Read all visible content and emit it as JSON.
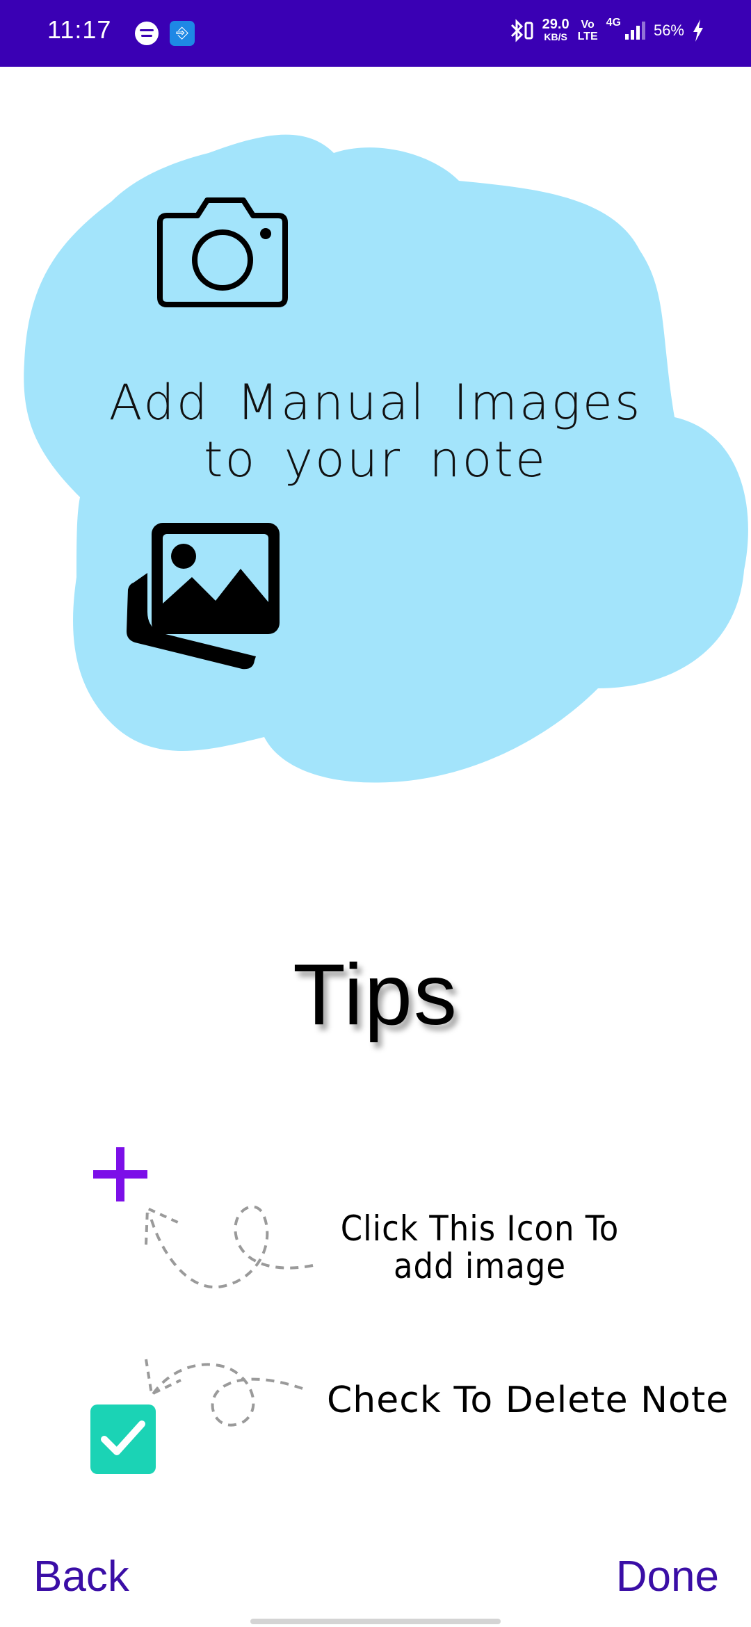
{
  "status_bar": {
    "time": "11:17",
    "speed_value": "29.0",
    "speed_unit": "KB/S",
    "volte_top": "Vo",
    "volte_bottom": "LTE",
    "network": "4G",
    "battery": "56%",
    "icons": [
      "spotify-icon",
      "usb-icon",
      "bluetooth-icon",
      "signal-icon",
      "charging-icon"
    ]
  },
  "illustration": {
    "title": "Add Manual Images to your note",
    "icons": [
      "camera-icon",
      "gallery-icon"
    ],
    "blob_color": "#a3e4fb"
  },
  "tips": {
    "heading": "Tips",
    "items": [
      {
        "icon": "plus-icon",
        "text": "Click This Icon To add image"
      },
      {
        "icon": "checkbox-icon",
        "text": "Check To Delete Note"
      }
    ]
  },
  "actions": {
    "back": "Back",
    "done": "Done"
  },
  "colors": {
    "status_bar": "#3a00b4",
    "accent": "#3a0ea6",
    "plus": "#7c0fe8",
    "checkbox": "#1bd3b5"
  }
}
